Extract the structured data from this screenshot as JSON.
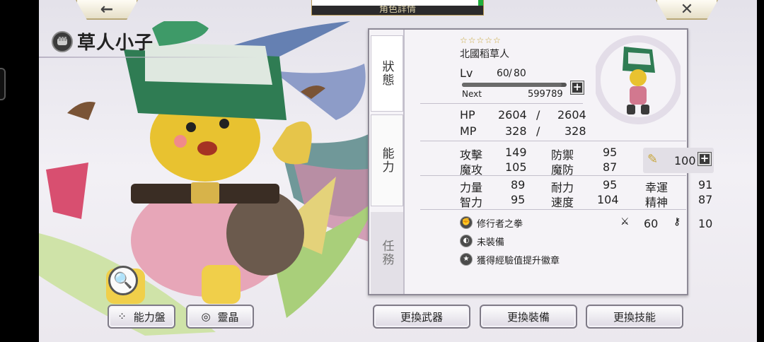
{
  "header": {
    "title": "角色詳情"
  },
  "character": {
    "name": "草人小子",
    "subtitle": "北國稻草人"
  },
  "tabs": [
    "狀態",
    "能力",
    "任務"
  ],
  "level": {
    "label": "Lv",
    "current": "60",
    "sep": "/",
    "max": "80",
    "next_label": "Next",
    "next_value": "599789",
    "xp_fraction": 0.95
  },
  "hp": {
    "label": "HP",
    "current": "2604",
    "sep": "/",
    "max": "2604"
  },
  "mp": {
    "label": "MP",
    "current": "328",
    "sep": "/",
    "max": "328"
  },
  "stats": [
    {
      "label": "攻擊",
      "value": "149"
    },
    {
      "label": "防禦",
      "value": "95"
    },
    {
      "label": "魔攻",
      "value": "105"
    },
    {
      "label": "魔防",
      "value": "87"
    },
    {
      "label": "力量",
      "value": "89"
    },
    {
      "label": "耐力",
      "value": "95"
    },
    {
      "label": "幸運",
      "value": "91"
    },
    {
      "label": "智力",
      "value": "95"
    },
    {
      "label": "速度",
      "value": "104"
    },
    {
      "label": "精神",
      "value": "87"
    }
  ],
  "wing_value": "100",
  "equipment": {
    "weapon": "修行者之拳",
    "gear": "未裝備",
    "badge": "獲得經驗值提升徽章",
    "weapon_stat1": "60",
    "weapon_stat2": "10"
  },
  "buttons": {
    "ability_board": "能力盤",
    "crystal": "靈晶",
    "change_weapon": "更換武器",
    "change_gear": "更換裝備",
    "change_skill": "更換技能"
  },
  "colors": {
    "star": "#c7a53a",
    "panel": "#f5f3f7"
  }
}
